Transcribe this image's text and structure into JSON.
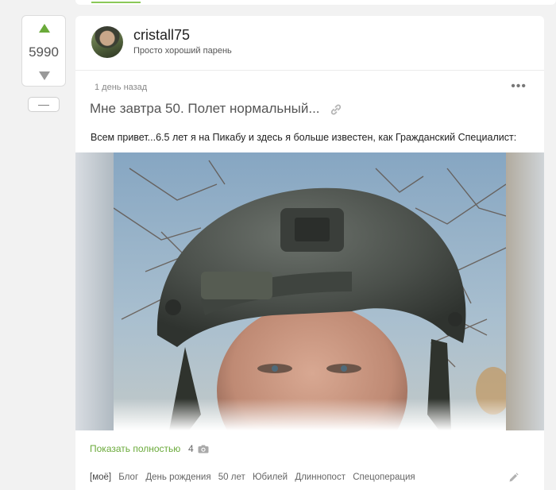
{
  "rating": {
    "score": "5990",
    "collapse_label": "—"
  },
  "author": {
    "name": "cristall75",
    "status": "Просто хороший парень"
  },
  "post": {
    "date": "1 день назад",
    "more_label": "•••",
    "title": "Мне завтра 50. Полет нормальный...",
    "text": "Всем привет...6.5 лет я на Пикабу и здесь я больше известен, как Гражданский Специалист:",
    "show_more_label": "Показать полностью",
    "photo_count": "4",
    "tags": [
      "[моё]",
      "Блог",
      "День рождения",
      "50 лет",
      "Юбилей",
      "Длиннопост",
      "Спецоперация"
    ]
  },
  "colors": {
    "accent": "#6aaa3a",
    "background": "#f2f2f2"
  },
  "icons": {
    "vote_up": "triangle-up-icon",
    "vote_down": "triangle-down-icon",
    "link": "link-icon",
    "camera": "camera-icon",
    "edit": "pencil-icon",
    "more": "more-dots-icon"
  }
}
